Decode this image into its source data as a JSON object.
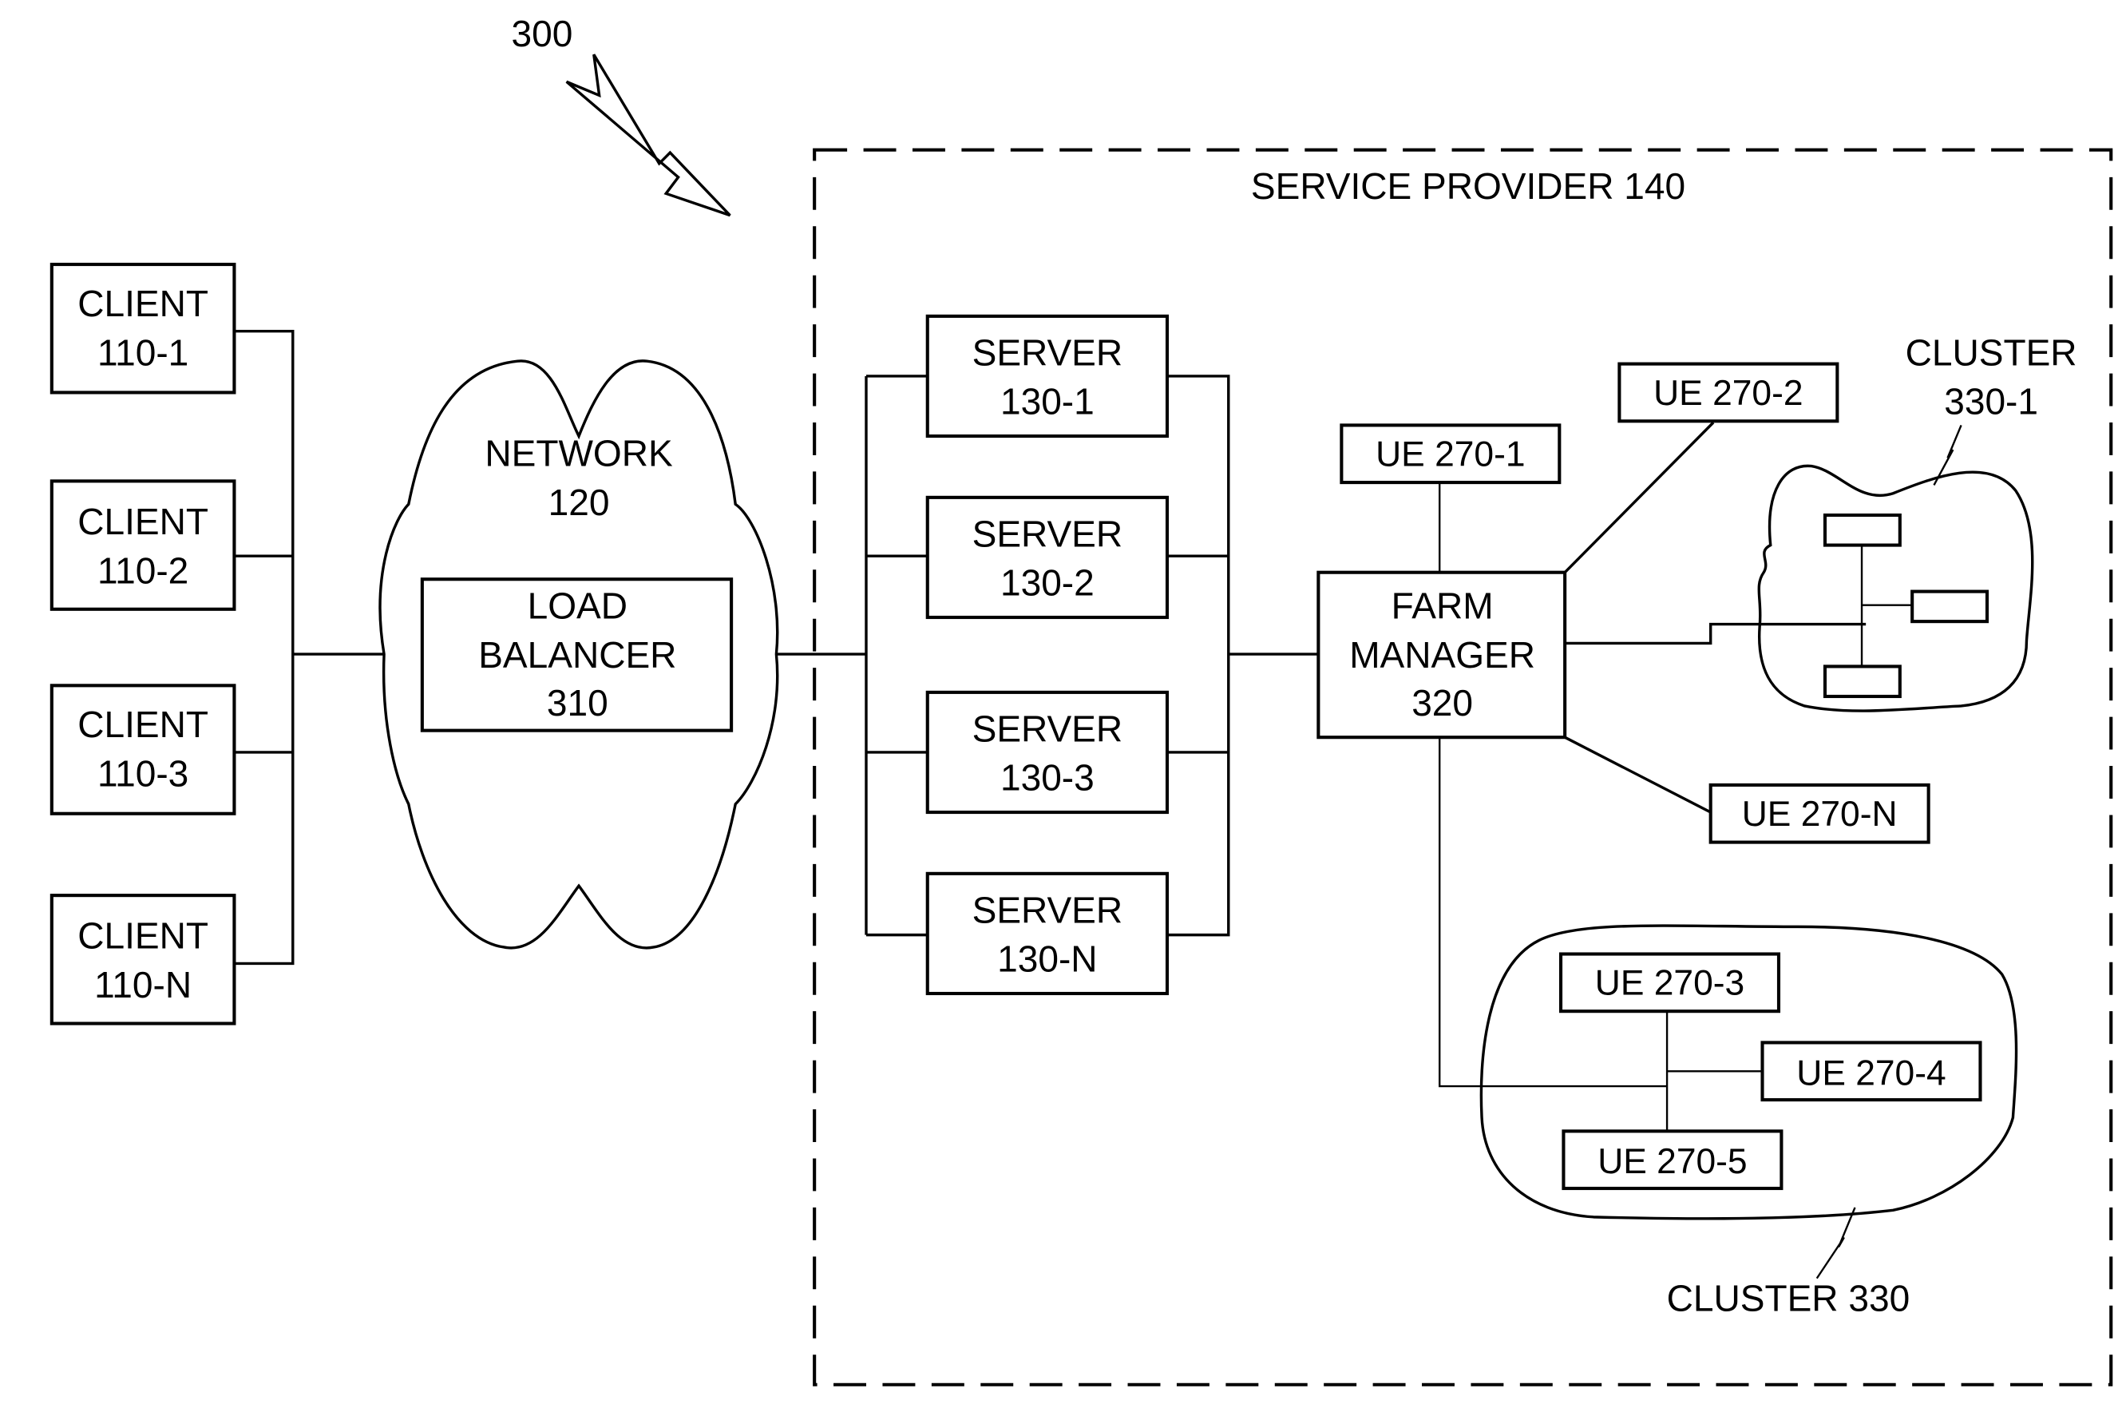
{
  "figure": {
    "ref": "300",
    "service_provider": "SERVICE PROVIDER 140",
    "clients": [
      {
        "line1": "CLIENT",
        "line2": "110-1"
      },
      {
        "line1": "CLIENT",
        "line2": "110-2"
      },
      {
        "line1": "CLIENT",
        "line2": "110-3"
      },
      {
        "line1": "CLIENT",
        "line2": "110-N"
      }
    ],
    "network": {
      "line1": "NETWORK",
      "line2": "120"
    },
    "load_balancer": {
      "line1": "LOAD",
      "line2": "BALANCER",
      "line3": "310"
    },
    "servers": [
      {
        "line1": "SERVER",
        "line2": "130-1"
      },
      {
        "line1": "SERVER",
        "line2": "130-2"
      },
      {
        "line1": "SERVER",
        "line2": "130-3"
      },
      {
        "line1": "SERVER",
        "line2": "130-N"
      }
    ],
    "farm_manager": {
      "line1": "FARM",
      "line2": "MANAGER",
      "line3": "320"
    },
    "ues": {
      "ue1": "UE 270-1",
      "ue2": "UE 270-2",
      "ueN": "UE 270-N",
      "ue3": "UE 270-3",
      "ue4": "UE 270-4",
      "ue5": "UE 270-5"
    },
    "cluster_1": {
      "line1": "CLUSTER",
      "line2": "330-1"
    },
    "cluster": "CLUSTER 330"
  }
}
